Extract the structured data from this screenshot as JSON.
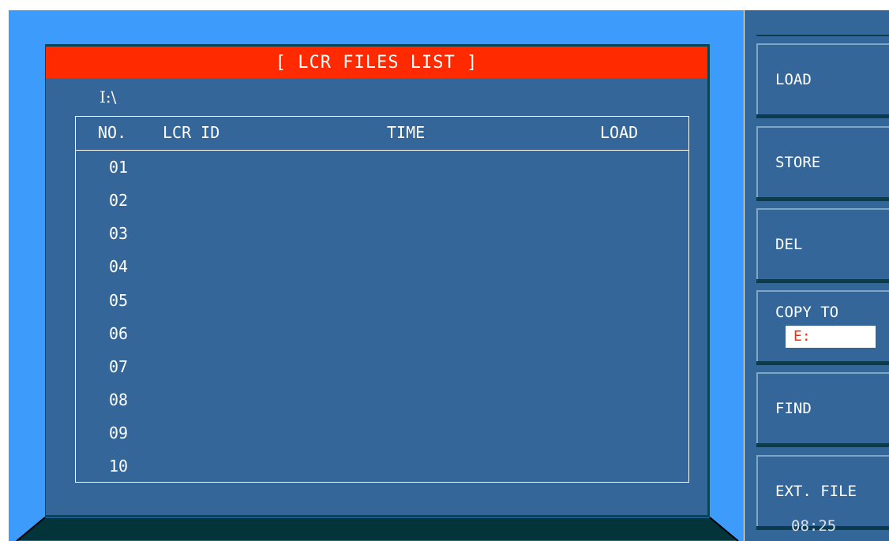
{
  "title": "[ LCR FILES LIST ]",
  "path": "I:\\",
  "table": {
    "headers": [
      "NO.",
      "LCR ID",
      "TIME",
      "LOAD"
    ],
    "rows": [
      "01",
      "02",
      "03",
      "04",
      "05",
      "06",
      "07",
      "08",
      "09",
      "10"
    ]
  },
  "softkeys": [
    {
      "label": "LOAD"
    },
    {
      "label": "STORE"
    },
    {
      "label": "DEL"
    },
    {
      "label": "COPY TO",
      "value": "E:"
    },
    {
      "label": "FIND"
    },
    {
      "label": "EXT. FILE"
    }
  ],
  "clock": "08:25",
  "colors": {
    "accent_red": "#ff2a00",
    "panel_blue": "#34669a",
    "frame_blue": "#3d9cfb",
    "dark": "#044656"
  }
}
